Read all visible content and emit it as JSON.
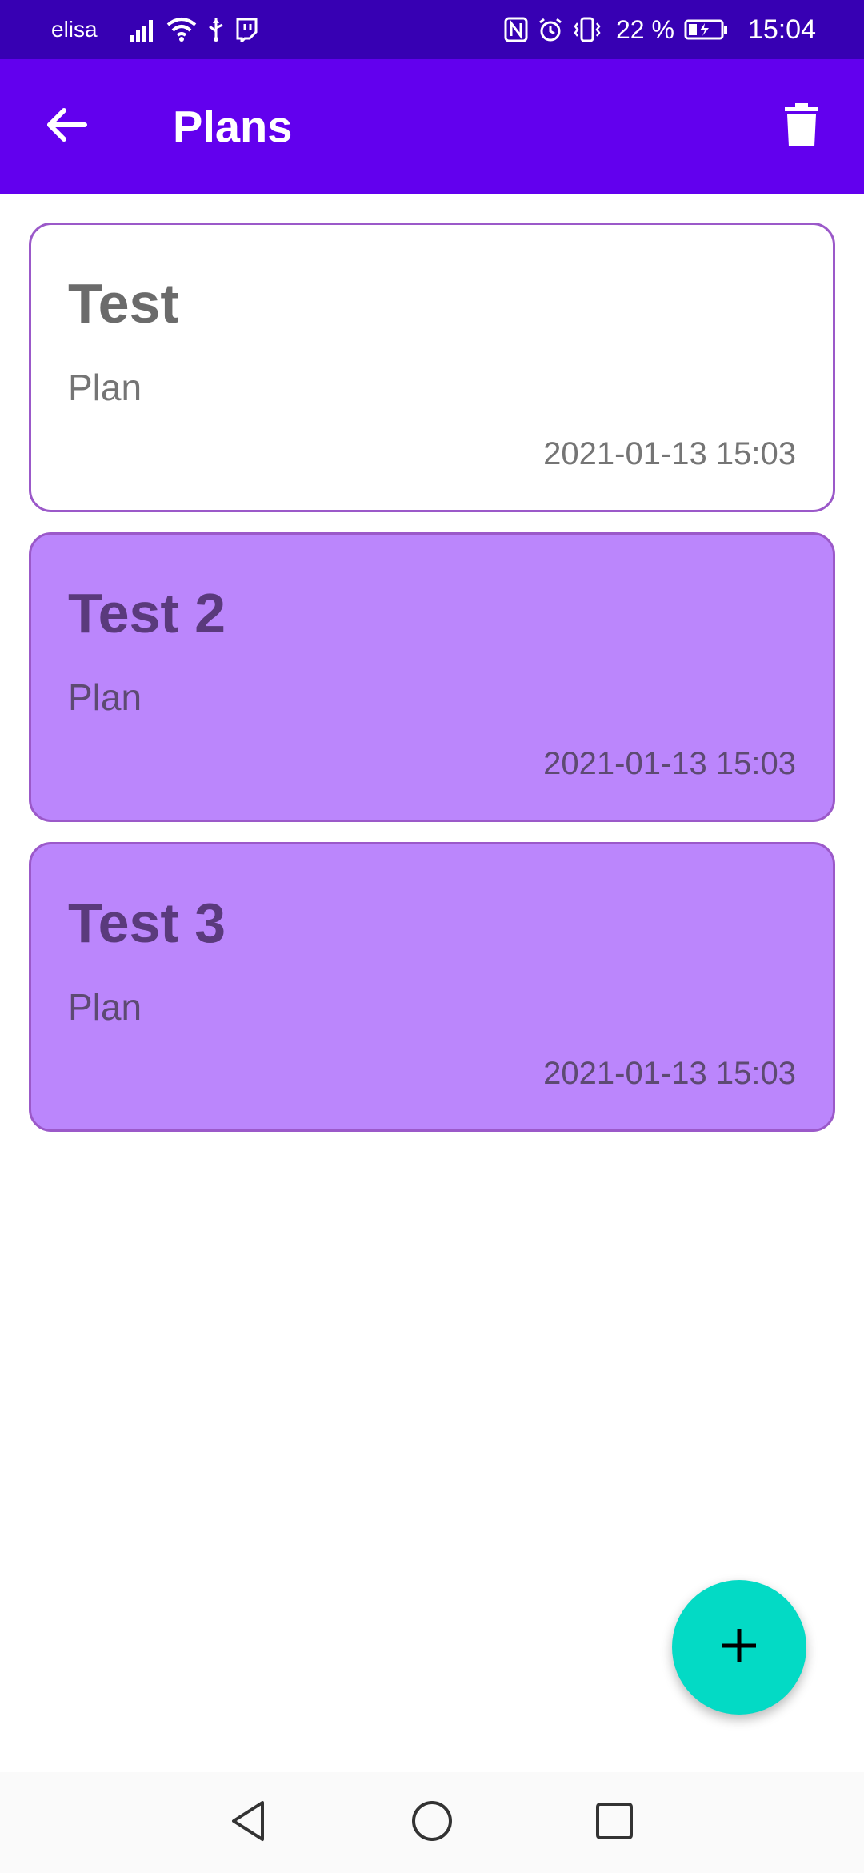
{
  "status_bar": {
    "carrier": "elisa",
    "battery_percent": "22 %",
    "time": "15:04",
    "icons": [
      "signal-icon",
      "wifi-icon",
      "usb-icon",
      "twitch-icon",
      "nfc-icon",
      "alarm-icon",
      "vibrate-icon",
      "battery-charging-icon"
    ]
  },
  "app_bar": {
    "title": "Plans",
    "back_icon": "arrow-back-icon",
    "delete_icon": "trash-icon",
    "background": "#6200ee"
  },
  "plans": [
    {
      "title": "Test",
      "subtitle": "Plan",
      "date": "2021-01-13 15:03",
      "style": "outlined"
    },
    {
      "title": "Test 2",
      "subtitle": "Plan",
      "date": "2021-01-13 15:03",
      "style": "filled"
    },
    {
      "title": "Test 3",
      "subtitle": "Plan",
      "date": "2021-01-13 15:03",
      "style": "filled"
    }
  ],
  "fab": {
    "icon": "plus-icon",
    "color": "#03dac5"
  },
  "nav_bar": {
    "icons": [
      "nav-back-icon",
      "nav-home-icon",
      "nav-recents-icon"
    ]
  },
  "colors": {
    "status_bar": "#3700b3",
    "primary": "#6200ee",
    "card_fill": "#bb86fc",
    "card_border": "#9b59c9",
    "accent": "#03dac5"
  }
}
